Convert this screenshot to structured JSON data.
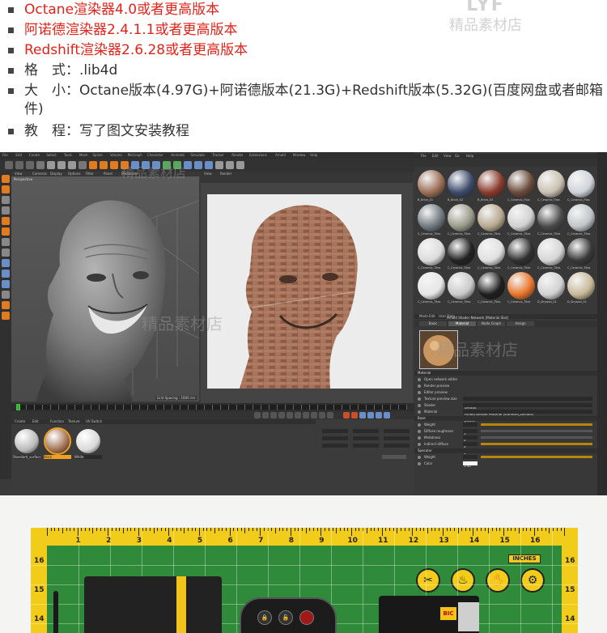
{
  "bullets": [
    {
      "text": "Octane渲染器4.0或者更高版本",
      "color": "#e3221a"
    },
    {
      "text": "阿诺德渲染器2.4.1.1或者更高版本",
      "color": "#e3221a"
    },
    {
      "text": "Redshift渲染器2.6.28或者更高版本",
      "color": "#e3221a"
    },
    {
      "text": "格　式：.lib4d",
      "color": "#333333"
    },
    {
      "text": "大　小：Octane版本(4.97G)+阿诺德版本(21.3G)+Redshift版本(5.32G)(百度网盘或者邮箱",
      "color": "#333333"
    },
    {
      "text": "件)",
      "color": "#333333"
    },
    {
      "text": "教　程：写了图文安装教程",
      "color": "#333333"
    }
  ],
  "watermark": {
    "brand": "LYF",
    "shop": "精品素材店"
  },
  "c4d": {
    "menu": [
      "File",
      "Edit",
      "Create",
      "Select",
      "Tools",
      "Mesh",
      "Spline",
      "Volume",
      "MoGraph",
      "Character",
      "Animate",
      "Simulate",
      "Tracker",
      "Render",
      "Extensions",
      "Arnold",
      "Window",
      "Help"
    ],
    "viewport_tabs": [
      "View",
      "Cameras",
      "Display",
      "Options",
      "Filter",
      "Panel",
      "ProRender"
    ],
    "viewport_label": "Perspective",
    "viewport_footer": "Grid Spacing : 1000 cm",
    "ipr_tabs": [
      "View",
      "Render"
    ],
    "content_browser_tabs": [
      "File",
      "Edit",
      "View",
      "Go",
      "Help"
    ],
    "material_tabs": [
      "Create",
      "Edit",
      "Function",
      "Texture",
      "UV Switch"
    ],
    "materials": [
      {
        "label": "Standard_surface",
        "color": "#b9b9b9"
      },
      {
        "label": "Brick",
        "color": "#a07050"
      },
      {
        "label": "White",
        "color": "#d8d8d8"
      }
    ],
    "library": [
      {
        "label": "B_Brick_01",
        "color": "#9b6e55"
      },
      {
        "label": "B_Brick_02",
        "color": "#3c4a6b"
      },
      {
        "label": "B_Brick_03",
        "color": "#8a3a2a"
      },
      {
        "label": "C_Ceramic_Floo",
        "color": "#6a4a3a"
      },
      {
        "label": "C_Ceramic_Floo",
        "color": "#c9c0b0"
      },
      {
        "label": "C_Ceramic_Floo",
        "color": "#cfd4da"
      },
      {
        "label": "C_Ceramic_Tiles",
        "color": "#707a80"
      },
      {
        "label": "C_Ceramic_Tiles",
        "color": "#9a9a8a"
      },
      {
        "label": "C_Ceramic_Tiles",
        "color": "#b8a890"
      },
      {
        "label": "C_Ceramic_Tiles",
        "color": "#d0d0d0"
      },
      {
        "label": "C_Ceramic_Tiles",
        "color": "#4a4a4a"
      },
      {
        "label": "C_Ceramic_Tiles",
        "color": "#c0c4c8"
      },
      {
        "label": "C_Ceramic_Tiles",
        "color": "#dcdcdc"
      },
      {
        "label": "C_Ceramic_Tiles",
        "color": "#222222"
      },
      {
        "label": "C_Ceramic_Tiles",
        "color": "#e0e0e0"
      },
      {
        "label": "C_Ceramic_Tiles",
        "color": "#303030"
      },
      {
        "label": "C_Ceramic_Tiles",
        "color": "#d6d6d6"
      },
      {
        "label": "C_Ceramic_Tiles",
        "color": "#383838"
      },
      {
        "label": "C_Ceramic_Tiles",
        "color": "#e6e6e6"
      },
      {
        "label": "C_Ceramic_Tiles",
        "color": "#cacaca"
      },
      {
        "label": "C_Ceramic_Tiles",
        "color": "#1e1e1e"
      },
      {
        "label": "C_Ceramic_Tiles",
        "color": "#e8742a"
      },
      {
        "label": "D_Drywall_01",
        "color": "#d2d2d2"
      },
      {
        "label": "D_Drywall_01",
        "color": "#c8b898"
      }
    ],
    "attributes": {
      "tabs": [
        "Mode",
        "Edit",
        "User Data"
      ],
      "title": "Arnold Shader Network [Material Slot]",
      "subtabs": [
        "Basic",
        "Material",
        "Node Graph",
        "Assign"
      ],
      "section_material": "Material",
      "rows": [
        {
          "label": "Open network editor"
        },
        {
          "label": "Render preview"
        },
        {
          "label": "Editor preview"
        },
        {
          "label": "Texture preview size",
          "value": "Default"
        },
        {
          "label": "Shader",
          "value": "Arnold Default Material (standard_surface)"
        },
        {
          "label": "Material",
          "value": "plastic"
        }
      ],
      "base": {
        "title": "Base",
        "rows": [
          {
            "label": "Weight",
            "value": "1",
            "fill": 1.0
          },
          {
            "label": "Diffuse roughness",
            "value": "0",
            "fill": 0.0
          },
          {
            "label": "Metalness",
            "value": "0",
            "fill": 0.0
          },
          {
            "label": "Indirect diffuse",
            "value": "1",
            "fill": 1.0
          }
        ]
      },
      "specular": {
        "title": "Specular",
        "rows": [
          {
            "label": "Weight",
            "value": "1.00",
            "fill": 1.0
          },
          {
            "label": "Color",
            "value": ""
          }
        ]
      }
    }
  },
  "mat": {
    "top_numbers": [
      "1",
      "2",
      "3",
      "4",
      "5",
      "6",
      "7",
      "8",
      "9",
      "10",
      "11",
      "12",
      "13",
      "14",
      "15",
      "16"
    ],
    "side_numbers": [
      "16",
      "15",
      "14"
    ],
    "inches_label": "INCHES",
    "warning_icons": [
      "no-blade-icon",
      "no-heat-icon",
      "no-fold-icon",
      "no-wheel-icon"
    ],
    "lighter_logo": "BIC"
  }
}
